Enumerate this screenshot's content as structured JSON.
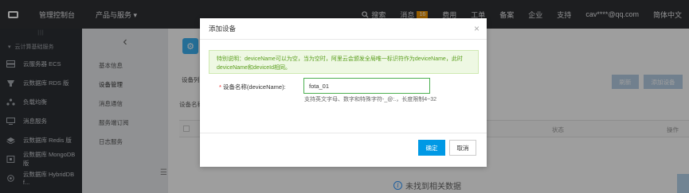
{
  "topbar": {
    "console": "管理控制台",
    "products": "产品与服务",
    "search": "搜索",
    "messages": "消息",
    "message_count": "16",
    "fees": "费用",
    "tickets": "工单",
    "icp": "备案",
    "enterprise": "企业",
    "support": "支持",
    "account": "cav****@qq.com",
    "language": "简体中文"
  },
  "sidebar": {
    "handle": "|||",
    "group": "云计算基础服务",
    "items": [
      {
        "label": "云服务器 ECS",
        "icon": "server-icon"
      },
      {
        "label": "云数据库 RDS 版",
        "icon": "database-icon"
      },
      {
        "label": "负载均衡",
        "icon": "load-balancer-icon"
      },
      {
        "label": "消息服务",
        "icon": "message-icon"
      },
      {
        "label": "云数据库 Redis 版",
        "icon": "redis-icon"
      },
      {
        "label": "云数据库 MongoDB 版",
        "icon": "mongodb-icon"
      },
      {
        "label": "云数据库 HybridDB f...",
        "icon": "hybriddb-icon"
      }
    ]
  },
  "subnav": {
    "back": "‹",
    "items": [
      "基本信息",
      "设备管理",
      "消息通信",
      "服务端订阅",
      "日志服务"
    ],
    "active_index": 1
  },
  "main": {
    "tab": "设备列",
    "device_name_label": "设备名称",
    "refresh_button": "刷新",
    "add_button": "添加设备",
    "status_header": "状态",
    "ops_header": "操作",
    "empty_text": "未找到相关数据"
  },
  "modal": {
    "title": "添加设备",
    "close": "×",
    "notice": "特别说明：deviceName可以为空，当为空时，阿里云会颁发全局唯一标识符作为deviceName，此时deviceName和deviceId相同。",
    "field_required": "*",
    "field_label": "设备名称(deviceName):",
    "field_value": "fota_01",
    "field_help": "支持英文字母、数字和特殊字符-_@:.，长度限制4~32",
    "ok_button": "确定",
    "cancel_button": "取消"
  },
  "colors": {
    "topbar_bg": "#2f3135",
    "sidebar_bg": "#2d3035",
    "primary": "#0099e5",
    "notice_bg": "#eef8e3",
    "notice_text": "#5a9e1d",
    "badge": "#f39800",
    "input_border": "#4caf50"
  }
}
